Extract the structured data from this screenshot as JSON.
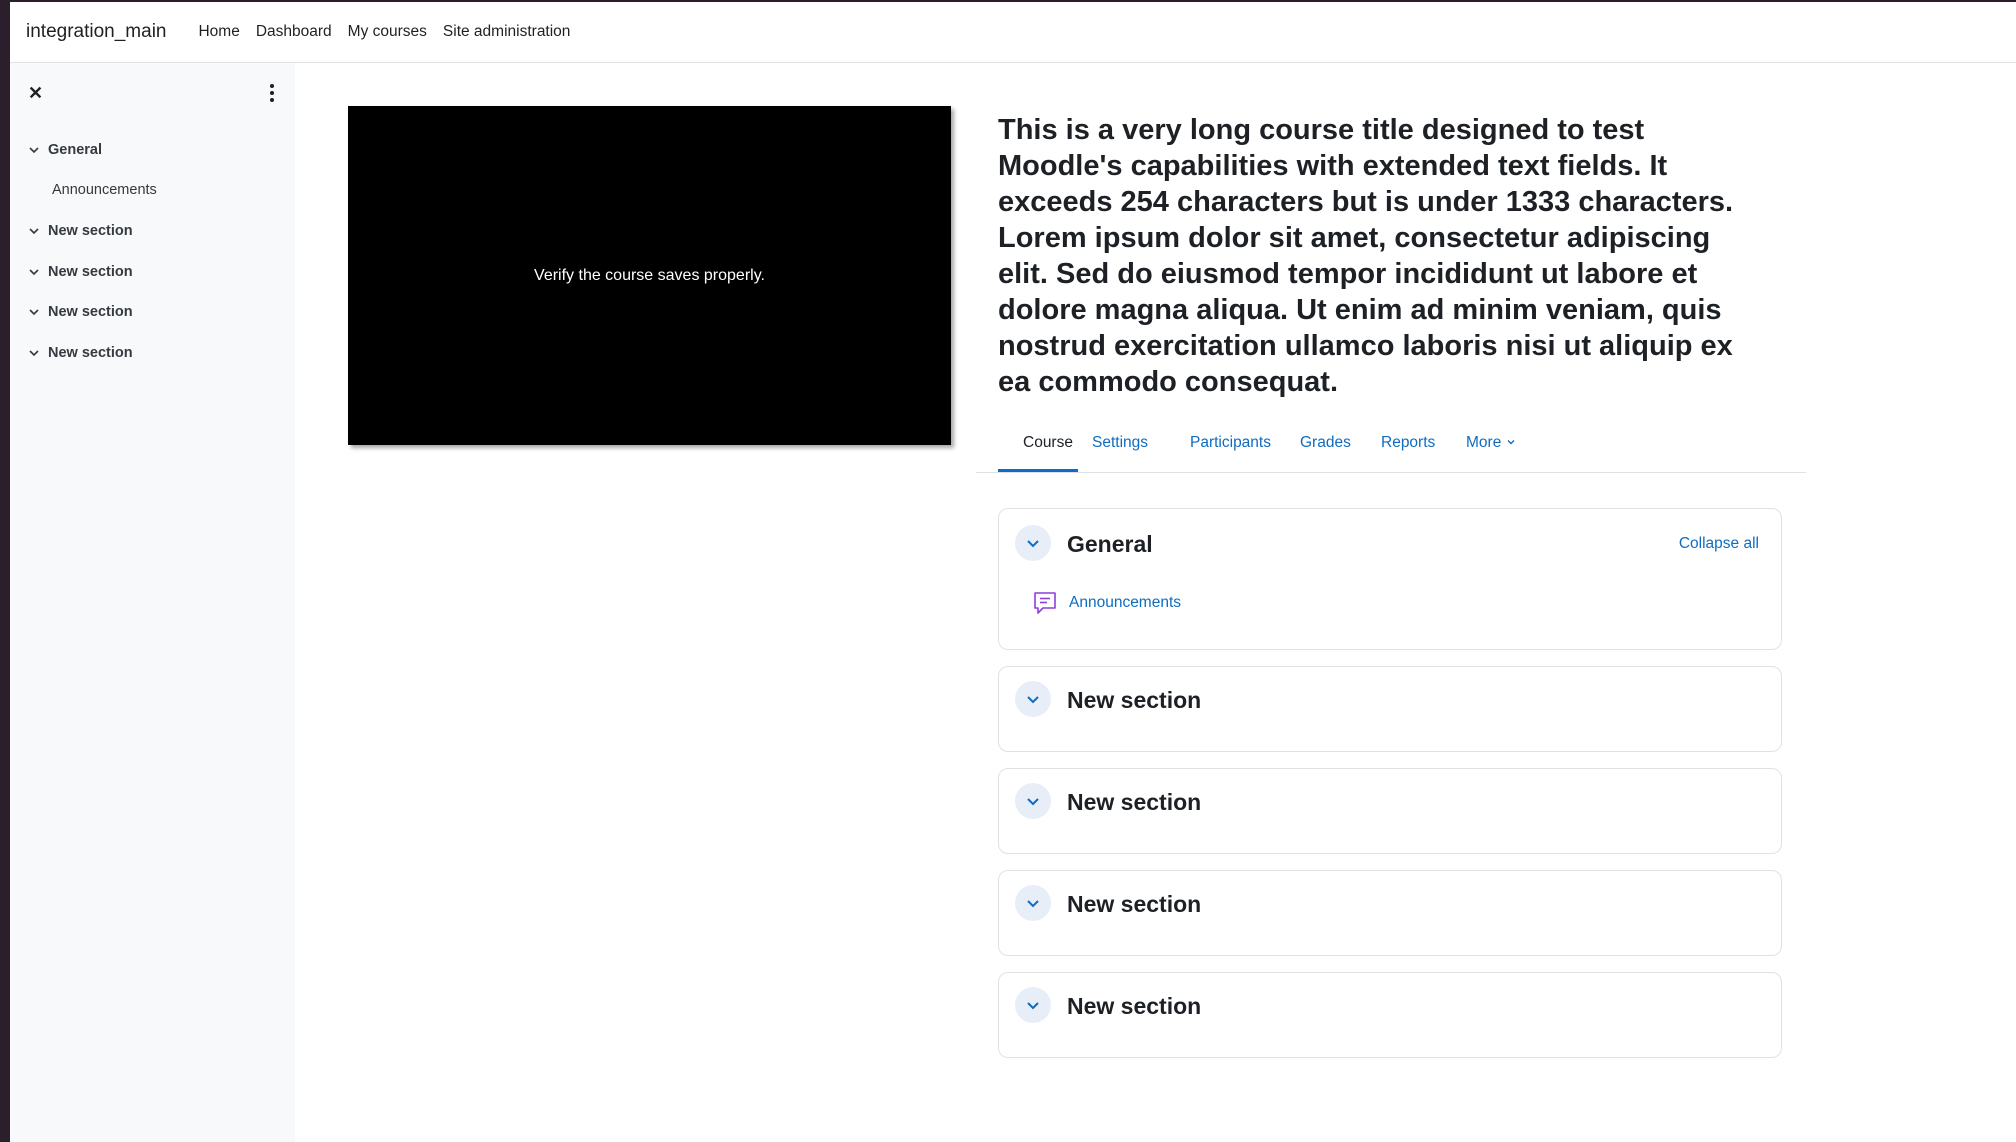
{
  "navbar": {
    "site_name": "integration_main",
    "links": [
      "Home",
      "Dashboard",
      "My courses",
      "Site administration"
    ]
  },
  "drawer": {
    "items": [
      {
        "label": "General",
        "sub": "Announcements"
      },
      {
        "label": "New section"
      },
      {
        "label": "New section"
      },
      {
        "label": "New section"
      },
      {
        "label": "New section"
      }
    ]
  },
  "course": {
    "image_text": "Verify the course saves properly.",
    "title": "This is a very long course title designed to test Moodle's capabilities with extended text fields. It exceeds 254 characters but is under 1333 characters. Lorem ipsum dolor sit amet, consectetur adipiscing elit. Sed do eiusmod tempor incididunt ut labore et dolore magna aliqua. Ut enim ad minim veniam, quis nostrud exercitation ullamco laboris nisi ut aliquip ex ea commodo consequat."
  },
  "tabs": {
    "items": [
      "Course",
      "Settings",
      "Participants",
      "Grades",
      "Reports",
      "More"
    ],
    "active": "Course"
  },
  "sections": {
    "collapse_all": "Collapse all",
    "general": {
      "title": "General",
      "activity": "Announcements",
      "activity_icon": "forum-icon"
    },
    "others": [
      "New section",
      "New section",
      "New section",
      "New section"
    ]
  },
  "colors": {
    "accent": "#0f6cbf",
    "activity_icon": "#8f3fd9"
  }
}
